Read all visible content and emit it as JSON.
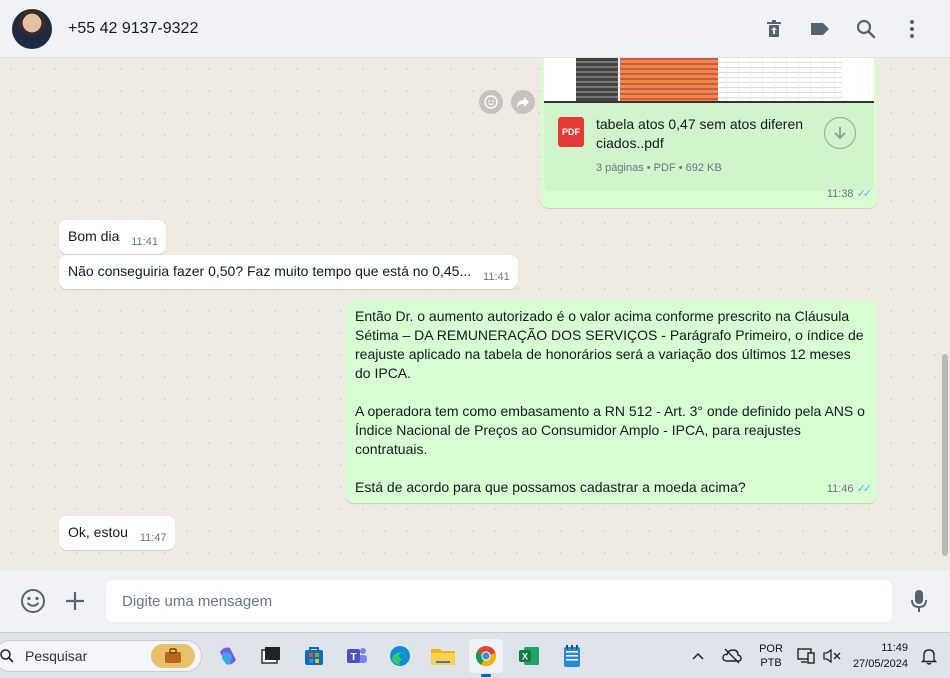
{
  "header": {
    "contact_name": "+55 42 9137-9322",
    "actions": [
      "delete-icon",
      "label-icon",
      "search-icon",
      "menu-icon"
    ]
  },
  "messages": [
    {
      "type": "document",
      "direction": "out",
      "file_name": "tabela atos 0,47 sem atos diferen ciados..pdf",
      "file_icon": "PDF",
      "meta": "3 páginas • PDF • 692 KB",
      "time": "11:38"
    },
    {
      "type": "text",
      "direction": "in",
      "text": "Bom dia",
      "time": "11:41"
    },
    {
      "type": "text",
      "direction": "in",
      "text": "Não conseguiria fazer 0,50? Faz muito tempo que está no 0,45...",
      "time": "11:41"
    },
    {
      "type": "text",
      "direction": "out",
      "paragraphs": [
        "Então Dr. o aumento autorizado é o valor acima conforme prescrito na Cláusula Sétima – DA REMUNERAÇÃO DOS SERVIÇOS - Parágrafo Primeiro, o índice de reajuste aplicado na tabela de honorários será a variação dos últimos 12 meses do IPCA.",
        "A operadora tem como embasamento a RN 512 - Art. 3° onde definido pela ANS o Índice Nacional de Preços ao Consumidor Amplo - IPCA, para reajustes contratuais.",
        "Está de acordo para que possamos cadastrar a moeda acima?"
      ],
      "time": "11:46"
    },
    {
      "type": "text",
      "direction": "in",
      "text": "Ok, estou",
      "time": "11:47"
    }
  ],
  "composer": {
    "placeholder": "Digite uma mensagem"
  },
  "taskbar": {
    "search_label": "Pesquisar",
    "language": {
      "line1": "POR",
      "line2": "PTB"
    },
    "clock": {
      "time": "11:49",
      "date": "27/05/2024"
    },
    "colors": {
      "accent": "#0067c0"
    }
  },
  "colors": {
    "outgoing_bubble": "#d9fdd3",
    "incoming_bubble": "#ffffff",
    "chat_background": "#efeae2",
    "read_ticks": "#53bdeb"
  }
}
